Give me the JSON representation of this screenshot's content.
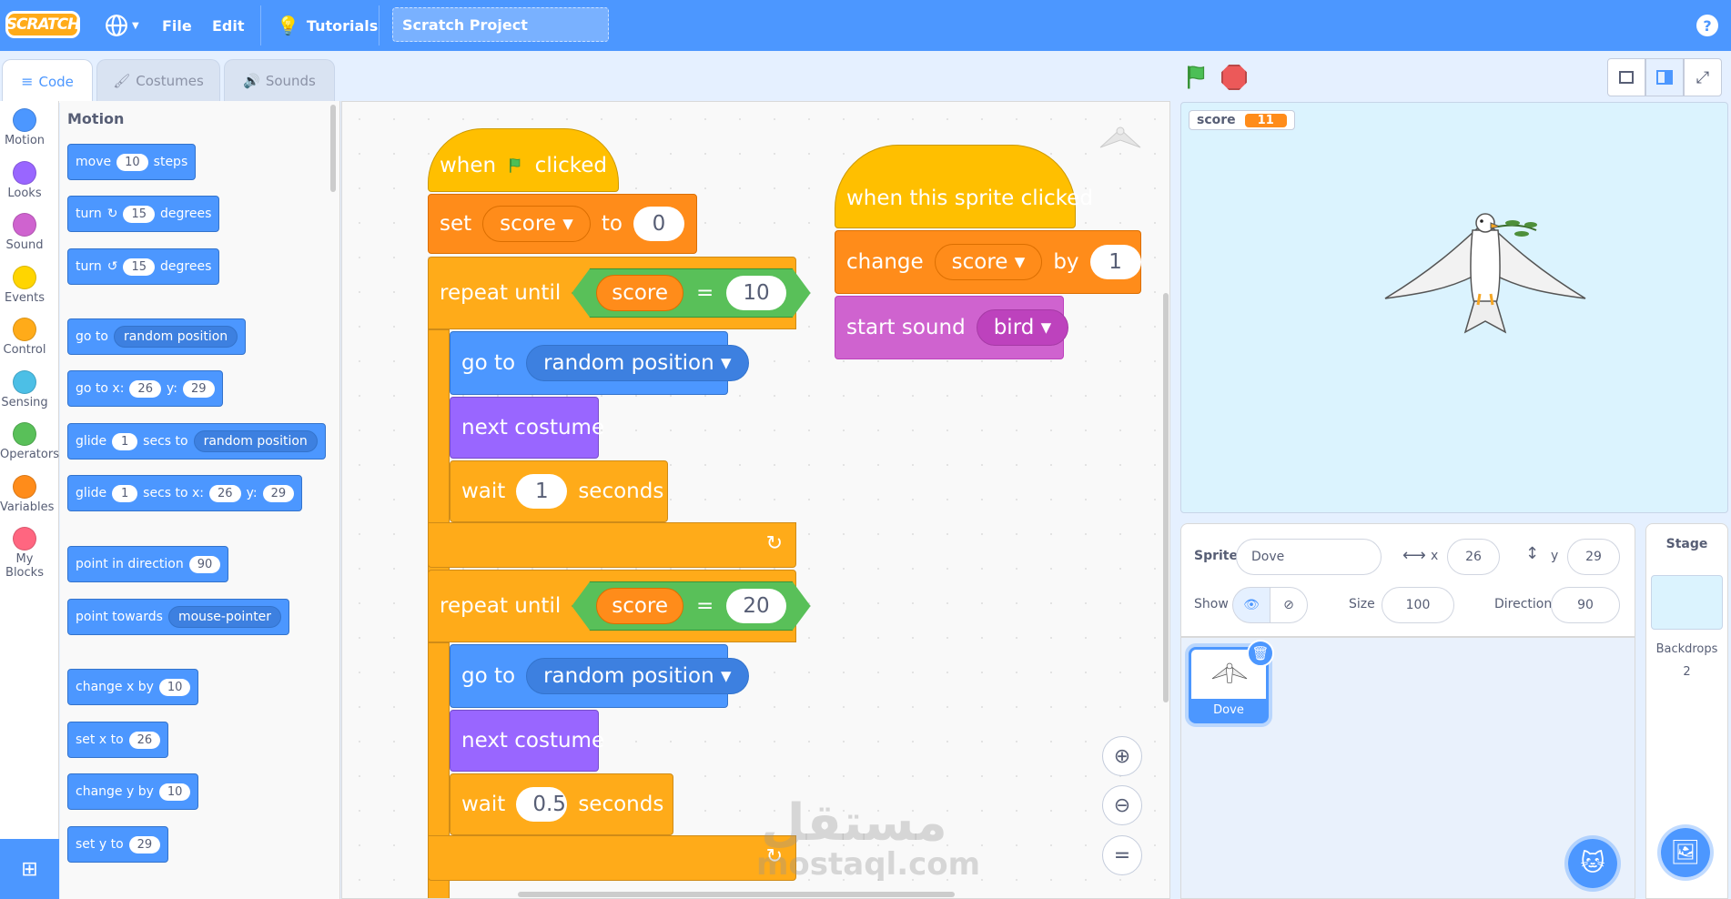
{
  "menu": {
    "logo": "SCRATCH",
    "file": "File",
    "edit": "Edit",
    "tutorials": "Tutorials",
    "project_title": "Scratch Project",
    "help": "?"
  },
  "tabs": {
    "code": "Code",
    "costumes": "Costumes",
    "sounds": "Sounds"
  },
  "categories": [
    {
      "label": "Motion",
      "color": "#4c97ff"
    },
    {
      "label": "Looks",
      "color": "#9966ff"
    },
    {
      "label": "Sound",
      "color": "#cf63cf"
    },
    {
      "label": "Events",
      "color": "#ffd500"
    },
    {
      "label": "Control",
      "color": "#ffab19"
    },
    {
      "label": "Sensing",
      "color": "#4cbfe6"
    },
    {
      "label": "Operators",
      "color": "#59c059"
    },
    {
      "label": "Variables",
      "color": "#ff8c1a"
    },
    {
      "label": "My Blocks",
      "color": "#ff6680"
    }
  ],
  "palette": {
    "heading": "Motion",
    "move": {
      "a": "move",
      "v": "10",
      "b": "steps"
    },
    "turn_right": {
      "a": "turn",
      "v": "15",
      "b": "degrees"
    },
    "turn_left": {
      "a": "turn",
      "v": "15",
      "b": "degrees"
    },
    "goto_random": {
      "a": "go to",
      "dd": "random position"
    },
    "goto_xy": {
      "a": "go to x:",
      "x": "26",
      "b": "y:",
      "y": "29"
    },
    "glide_random": {
      "a": "glide",
      "v": "1",
      "b": "secs to",
      "dd": "random position"
    },
    "glide_xy": {
      "a": "glide",
      "v": "1",
      "b": "secs to x:",
      "x": "26",
      "c": "y:",
      "y": "29"
    },
    "point_dir": {
      "a": "point in direction",
      "v": "90"
    },
    "point_towards": {
      "a": "point towards",
      "dd": "mouse-pointer"
    },
    "change_x": {
      "a": "change x by",
      "v": "10"
    },
    "set_x": {
      "a": "set x to",
      "v": "26"
    },
    "change_y": {
      "a": "change y by",
      "v": "10"
    },
    "set_y": {
      "a": "set y to",
      "v": "29"
    }
  },
  "script1": {
    "hat": {
      "a": "when",
      "b": "clicked"
    },
    "set": {
      "a": "set",
      "var": "score",
      "b": "to",
      "v": "0"
    },
    "repeat1": {
      "a": "repeat until",
      "var": "score",
      "op": "=",
      "v": "10"
    },
    "goto1": {
      "a": "go to",
      "dd": "random position"
    },
    "costume1": "next costume",
    "wait1": {
      "a": "wait",
      "v": "1",
      "b": "seconds"
    },
    "repeat2": {
      "a": "repeat until",
      "var": "score",
      "op": "=",
      "v": "20"
    },
    "goto2": {
      "a": "go to",
      "dd": "random position"
    },
    "costume2": "next costume",
    "wait2": {
      "a": "wait",
      "v": "0.5",
      "b": "seconds"
    }
  },
  "script2": {
    "hat": "when this sprite clicked",
    "change": {
      "a": "change",
      "var": "score",
      "b": "by",
      "v": "1"
    },
    "sound": {
      "a": "start sound",
      "dd": "bird"
    }
  },
  "watermark": {
    "arabic": "مستقل",
    "latin": "mostaql.com"
  },
  "monitor": {
    "name": "score",
    "value": "11"
  },
  "sprite_info": {
    "sprite_label": "Sprite",
    "sprite_name": "Dove",
    "x_label": "x",
    "x": "26",
    "y_label": "y",
    "y": "29",
    "show_label": "Show",
    "size_label": "Size",
    "size": "100",
    "direction_label": "Direction",
    "direction": "90"
  },
  "sprites": [
    {
      "name": "Dove"
    }
  ],
  "stage_pane": {
    "title": "Stage",
    "backdrops_label": "Backdrops",
    "backdrops_count": "2"
  }
}
